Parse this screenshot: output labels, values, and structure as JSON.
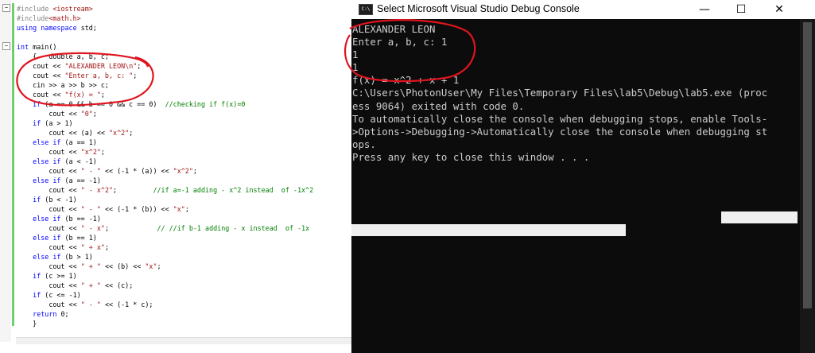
{
  "editor": {
    "lines": [
      [
        [
          "pp",
          "#include "
        ],
        [
          "str",
          "<iostream>"
        ]
      ],
      [
        [
          "pp",
          "#include"
        ],
        [
          "str",
          "<math.h>"
        ]
      ],
      [
        [
          "kw",
          "using namespace "
        ],
        [
          "",
          "std;"
        ]
      ],
      [
        [
          "",
          ""
        ]
      ],
      [
        [
          "kw",
          "int "
        ],
        [
          "",
          "main()"
        ]
      ],
      [
        [
          "",
          "    {   double a, b, c;"
        ]
      ],
      [
        [
          "",
          "    cout << "
        ],
        [
          "str",
          "\"ALEXANDER LEON\\n\""
        ],
        [
          "",
          ";"
        ]
      ],
      [
        [
          "",
          "    cout << "
        ],
        [
          "str",
          "\"Enter a, b, c: \""
        ],
        [
          "",
          ";"
        ]
      ],
      [
        [
          "",
          "    cin >> a >> b >> c;"
        ]
      ],
      [
        [
          "",
          "    cout << "
        ],
        [
          "str",
          "\"f(x) = \""
        ],
        [
          "",
          ";"
        ]
      ],
      [
        [
          "kw",
          "    if "
        ],
        [
          "",
          "(a == 0 && b == 0 && c == 0)  "
        ],
        [
          "cm",
          "//checking if f(x)=0"
        ]
      ],
      [
        [
          "",
          "        cout << "
        ],
        [
          "str",
          "\"0\""
        ],
        [
          "",
          ";"
        ]
      ],
      [
        [
          "kw",
          "    if "
        ],
        [
          "",
          "(a > 1)"
        ]
      ],
      [
        [
          "",
          "        cout << (a) << "
        ],
        [
          "str",
          "\"x^2\""
        ],
        [
          "",
          ";"
        ]
      ],
      [
        [
          "kw",
          "    else if "
        ],
        [
          "",
          "(a == 1)"
        ]
      ],
      [
        [
          "",
          "        cout << "
        ],
        [
          "str",
          "\"x^2\""
        ],
        [
          "",
          ";"
        ]
      ],
      [
        [
          "kw",
          "    else if "
        ],
        [
          "",
          "(a < -1)"
        ]
      ],
      [
        [
          "",
          "        cout << "
        ],
        [
          "str",
          "\" - \""
        ],
        [
          "",
          " << (-1 * (a)) << "
        ],
        [
          "str",
          "\"x^2\""
        ],
        [
          "",
          ";"
        ]
      ],
      [
        [
          "kw",
          "    else if "
        ],
        [
          "",
          "(a == -1)"
        ]
      ],
      [
        [
          "",
          "        cout << "
        ],
        [
          "str",
          "\" - x^2\""
        ],
        [
          "",
          ";         "
        ],
        [
          "cm",
          "//if a=-1 adding - x^2 instead  of -1x^2"
        ]
      ],
      [
        [
          "kw",
          "    if "
        ],
        [
          "",
          "(b < -1)"
        ]
      ],
      [
        [
          "",
          "        cout << "
        ],
        [
          "str",
          "\" - \""
        ],
        [
          "",
          " << (-1 * (b)) << "
        ],
        [
          "str",
          "\"x\""
        ],
        [
          "",
          ";"
        ]
      ],
      [
        [
          "kw",
          "    else if "
        ],
        [
          "",
          "(b == -1)"
        ]
      ],
      [
        [
          "",
          "        cout << "
        ],
        [
          "str",
          "\" - x\""
        ],
        [
          "",
          ";            "
        ],
        [
          "cm",
          "// //if b-1 adding - x instead  of -1x"
        ]
      ],
      [
        [
          "kw",
          "    else if "
        ],
        [
          "",
          "(b == 1)"
        ]
      ],
      [
        [
          "",
          "        cout << "
        ],
        [
          "str",
          "\" + x\""
        ],
        [
          "",
          ";"
        ]
      ],
      [
        [
          "kw",
          "    else if "
        ],
        [
          "",
          "(b > 1)"
        ]
      ],
      [
        [
          "",
          "        cout << "
        ],
        [
          "str",
          "\" + \""
        ],
        [
          "",
          " << (b) << "
        ],
        [
          "str",
          "\"x\""
        ],
        [
          "",
          ";"
        ]
      ],
      [
        [
          "kw",
          "    if "
        ],
        [
          "",
          "(c >= 1)"
        ]
      ],
      [
        [
          "",
          "        cout << "
        ],
        [
          "str",
          "\" + \""
        ],
        [
          "",
          " << (c);"
        ]
      ],
      [
        [
          "kw",
          "    if "
        ],
        [
          "",
          "(c <= -1)"
        ]
      ],
      [
        [
          "",
          "        cout << "
        ],
        [
          "str",
          "\" - \""
        ],
        [
          "",
          " << (-1 * c);"
        ]
      ],
      [
        [
          "kw",
          "    return "
        ],
        [
          "",
          "0;"
        ]
      ],
      [
        [
          "",
          "    }"
        ]
      ]
    ]
  },
  "console": {
    "title": "Select Microsoft Visual Studio Debug Console",
    "icon_label": "C:\\",
    "minimize_glyph": "—",
    "maximize_glyph": "☐",
    "close_glyph": "✕",
    "output": "ALEXANDER LEON\nEnter a, b, c: 1\n1\n1\nf(x) = x^2 + x + 1\nC:\\Users\\PhotonUser\\My Files\\Temporary Files\\lab5\\Debug\\lab5.exe (proc\ness 9064) exited with code 0.\nTo automatically close the console when debugging stops, enable Tools-\n>Options->Debugging->Automatically close the console when debugging st\nops.\nPress any key to close this window . . ."
  },
  "annotation_color": "#e0141e"
}
